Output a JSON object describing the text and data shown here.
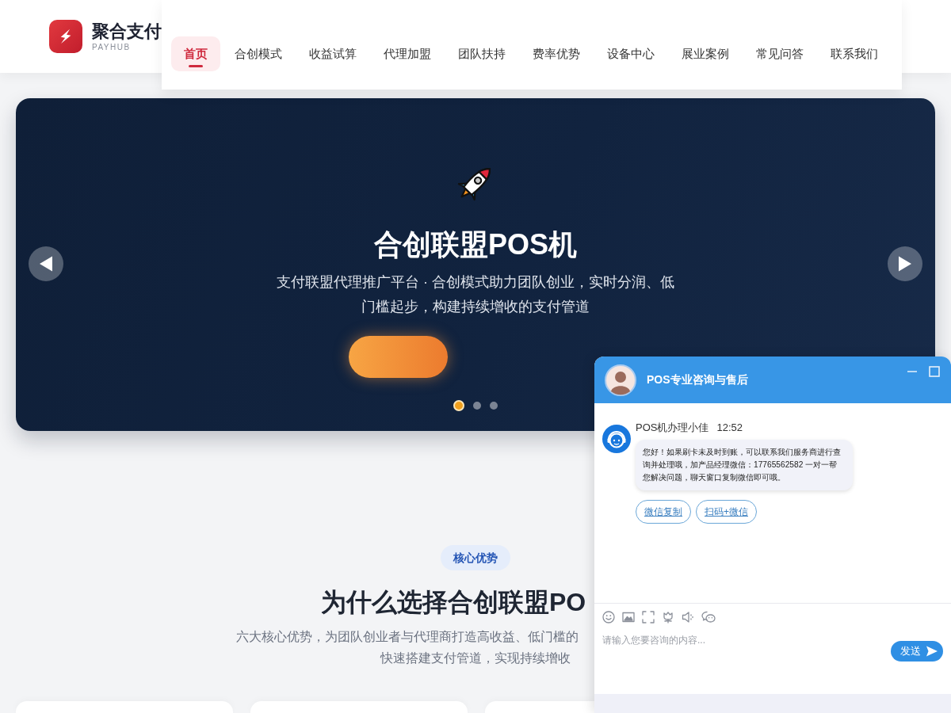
{
  "header": {
    "logo": {
      "name": "聚合支付",
      "tagline": "PAYHUB"
    },
    "nav": [
      {
        "label": "首页",
        "selected": true
      },
      {
        "label": "合创模式",
        "selected": false
      },
      {
        "label": "收益试算",
        "selected": false
      },
      {
        "label": "代理加盟",
        "selected": false
      },
      {
        "label": "团队扶持",
        "selected": false
      },
      {
        "label": "费率优势",
        "selected": false
      },
      {
        "label": "设备中心",
        "selected": false
      },
      {
        "label": "展业案例",
        "selected": false
      },
      {
        "label": "常见问答",
        "selected": false
      },
      {
        "label": "联系我们",
        "selected": false
      }
    ]
  },
  "hero": {
    "title": "合创联盟POS机",
    "subtitle": "支付联盟代理推广平台 · 合创模式助力团队创业，实时分润、低门槛起步，构建持续增收的支付管道",
    "slides": [
      {
        "selected": true
      },
      {
        "selected": false
      },
      {
        "selected": false
      }
    ]
  },
  "features": {
    "badge": "核心优势",
    "heading": "为什么选择合创联盟PO",
    "subtitle_lines": [
      "六大核心优势，为团队创业者与代理商打造高收益、低门槛的",
      "快速搭建支付管道，实现持续增收"
    ]
  },
  "chat": {
    "title": "POS专业咨询与售后",
    "messages": [
      {
        "sender": "POS机办理小佳",
        "time": "12:52",
        "text": "您好！如果刷卡未及时到账，可以联系我们服务商进行查询并处理哦，加产品经理微信：17765562582 一对一帮您解决问题，聊天窗口复制微信即可哦。",
        "actions": [
          "微信复制",
          "扫码+微信"
        ]
      }
    ],
    "input": {
      "placeholder": "请输入您要咨询的内容..."
    },
    "send_button": "发送"
  }
}
